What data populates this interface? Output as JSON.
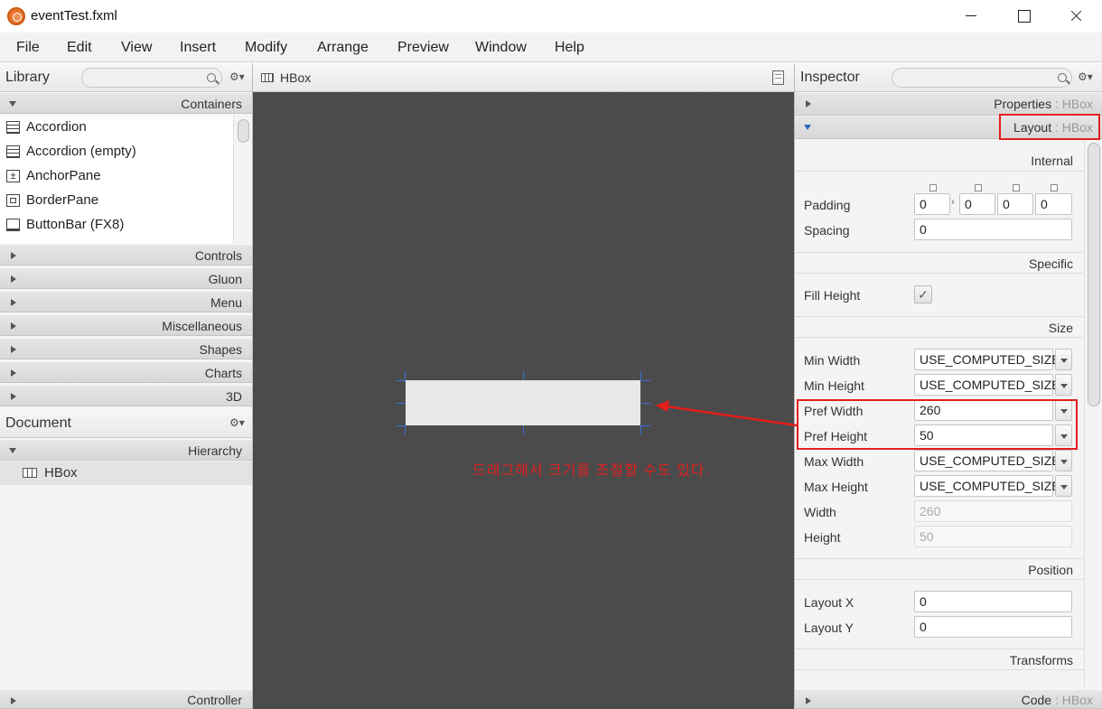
{
  "window": {
    "title": "eventTest.fxml"
  },
  "menubar": [
    "File",
    "Edit",
    "View",
    "Insert",
    "Modify",
    "Arrange",
    "Preview",
    "Window",
    "Help"
  ],
  "library": {
    "title": "Library",
    "sections": {
      "containers": "Containers",
      "controls": "Controls",
      "gluon": "Gluon",
      "menu": "Menu",
      "miscellaneous": "Miscellaneous",
      "shapes": "Shapes",
      "charts": "Charts",
      "three_d": "3D"
    },
    "items": [
      "Accordion",
      "Accordion  (empty)",
      "AnchorPane",
      "BorderPane",
      "ButtonBar  (FX8)"
    ]
  },
  "document": {
    "title": "Document",
    "hierarchy_label": "Hierarchy",
    "root_node": "HBox",
    "controller_label": "Controller"
  },
  "canvas": {
    "tab_label": "HBox",
    "annotation": "드래그해서 크기를 조절할 수도 있다."
  },
  "inspector": {
    "title": "Inspector",
    "properties_section": {
      "label": "Properties",
      "sep": " : ",
      "type": "HBox"
    },
    "layout_section": {
      "label": "Layout",
      "sep": " : ",
      "type": "HBox"
    },
    "code_section": {
      "label": "Code",
      "sep": " : ",
      "type": "HBox"
    },
    "groups": {
      "internal": "Internal",
      "specific": "Specific",
      "size": "Size",
      "position": "Position",
      "transforms": "Transforms"
    },
    "padding": {
      "label": "Padding",
      "top": "0",
      "right": "0",
      "bottom": "0",
      "left": "0"
    },
    "spacing": {
      "label": "Spacing",
      "value": "0"
    },
    "fill_height": {
      "label": "Fill Height",
      "checked": true
    },
    "min_width": {
      "label": "Min Width",
      "value": "USE_COMPUTED_SIZE"
    },
    "min_height": {
      "label": "Min Height",
      "value": "USE_COMPUTED_SIZE"
    },
    "pref_width": {
      "label": "Pref Width",
      "value": "260"
    },
    "pref_height": {
      "label": "Pref Height",
      "value": "50"
    },
    "max_width": {
      "label": "Max Width",
      "value": "USE_COMPUTED_SIZE"
    },
    "max_height": {
      "label": "Max Height",
      "value": "USE_COMPUTED_SIZE"
    },
    "width": {
      "label": "Width",
      "value": "260"
    },
    "height": {
      "label": "Height",
      "value": "50"
    },
    "layout_x": {
      "label": "Layout X",
      "value": "0"
    },
    "layout_y": {
      "label": "Layout Y",
      "value": "0"
    }
  },
  "colors": {
    "annotation_red": "#e41e1e",
    "canvas_bg": "#4a4a4a",
    "selection_blue": "#3a6fd8"
  }
}
